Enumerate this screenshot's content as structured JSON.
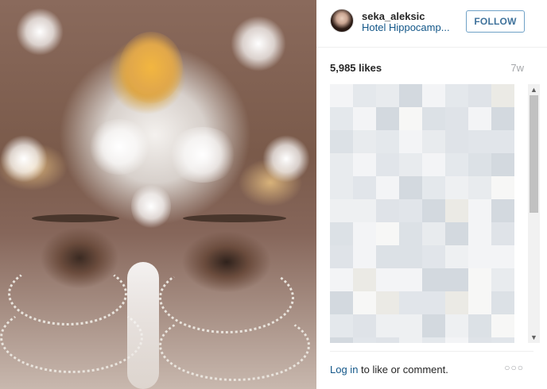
{
  "post": {
    "username": "seka_aleksic",
    "location": "Hotel Hippocamp...",
    "follow_label": "FOLLOW",
    "likes": "5,985 likes",
    "age": "7w"
  },
  "footer": {
    "login_link": "Log in",
    "login_text": " to like or comment.",
    "more_glyph": "○○○"
  },
  "scrollbar": {
    "up_glyph": "▲",
    "down_glyph": "▼"
  },
  "icons": [
    "more-options-icon",
    "scroll-up-arrow-icon",
    "scroll-down-arrow-icon"
  ],
  "colors": {
    "link": "#125688",
    "follow_border": "#70a2c7",
    "follow_text": "#3f729b",
    "muted": "#a5a7aa"
  }
}
